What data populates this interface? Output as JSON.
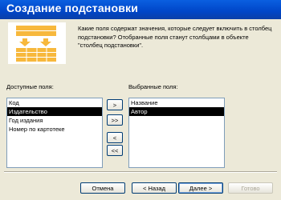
{
  "window": {
    "title": "Создание подстановки"
  },
  "description": "Какие поля содержат значения, которые следует включить в столбец подстановки? Отобранные поля станут столбцами в объекте \"столбец подстановки\".",
  "available": {
    "label": "Доступные поля:",
    "items": [
      "Код",
      "Издательство",
      "Год издания",
      "Номер по картотеке"
    ],
    "selected_index": 1
  },
  "selected": {
    "label": "Выбранные поля:",
    "items": [
      "Название",
      "Автор"
    ],
    "selected_index": 1
  },
  "transfer_buttons": {
    "add_one": ">",
    "add_all": ">>",
    "remove_one": "<",
    "remove_all": "<<"
  },
  "footer": {
    "cancel": "Отмена",
    "back": "< Назад",
    "next": "Далее >",
    "finish": "Готово"
  },
  "colors": {
    "titlebar": "#0A5FE0",
    "dialog_bg": "#ECE9D8",
    "selection_bg": "#000000",
    "graphic_orange": "#F7B83C"
  }
}
